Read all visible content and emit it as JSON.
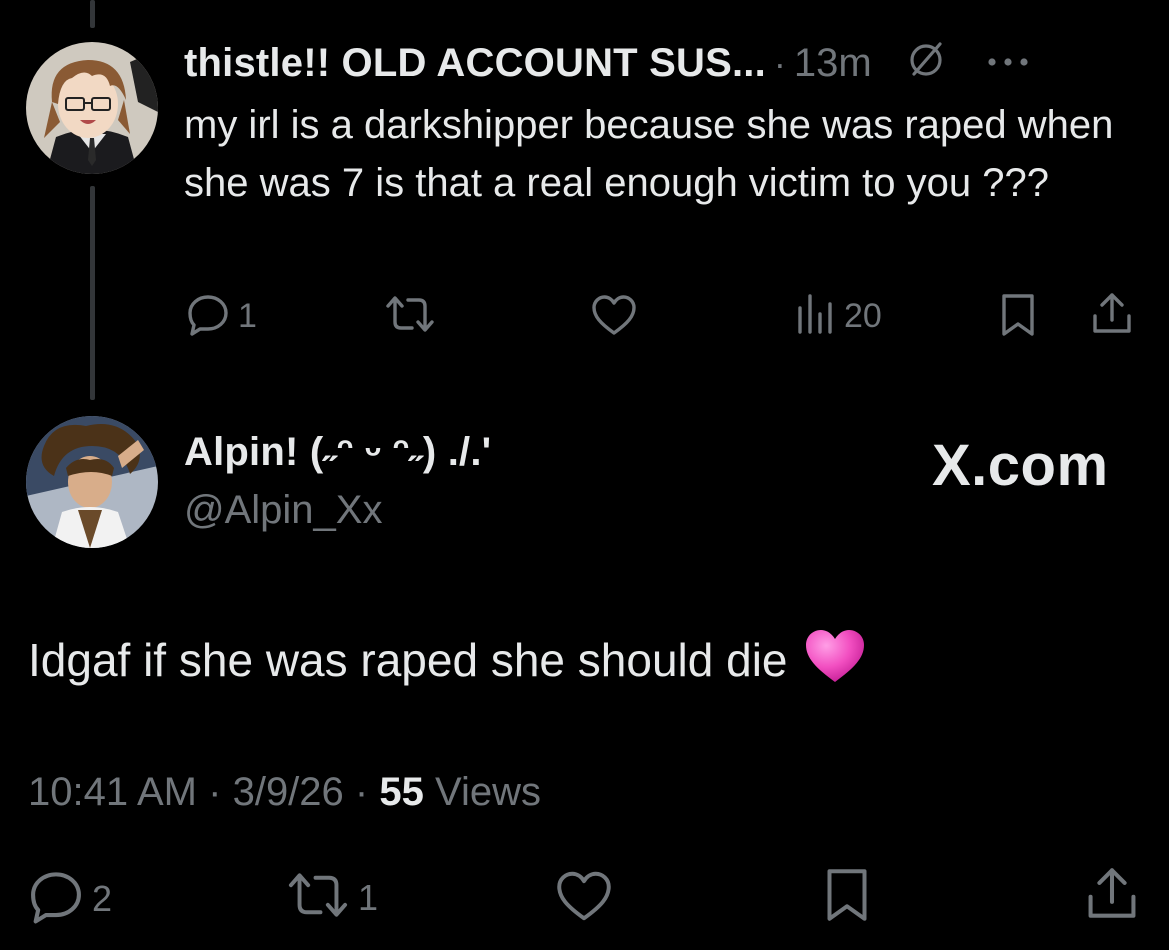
{
  "tweet": {
    "display_name": "thistle!! OLD ACCOUNT SUS...",
    "separator": "·",
    "time": "13m",
    "text": "my irl is a darkshipper because she was raped when she was 7 is that a real enough victim to you ???",
    "actions": {
      "reply_count": "1",
      "repost_count": "",
      "views_count": "20"
    },
    "icons": [
      "avatar",
      "grok-icon",
      "more-icon",
      "reply-icon",
      "repost-icon",
      "like-icon",
      "views-icon",
      "bookmark-icon",
      "share-icon"
    ]
  },
  "reply": {
    "display_name": "Alpin! (˶ᵔ ᵕ ᵔ˶) ./.'",
    "handle": "@Alpin_Xx",
    "text": "Idgaf if she was raped she should die",
    "emoji": "💗",
    "time": "10:41 AM",
    "date": "3/9/26",
    "views_count": "55",
    "views_label": "Views",
    "actions": {
      "reply_count": "2",
      "repost_count": "1"
    }
  },
  "watermark": "X.com",
  "colors": {
    "background": "#000000",
    "text_primary": "#e7e9ea",
    "text_secondary": "#71767b",
    "thread_line": "#333639",
    "heart": "#f24fc1"
  }
}
